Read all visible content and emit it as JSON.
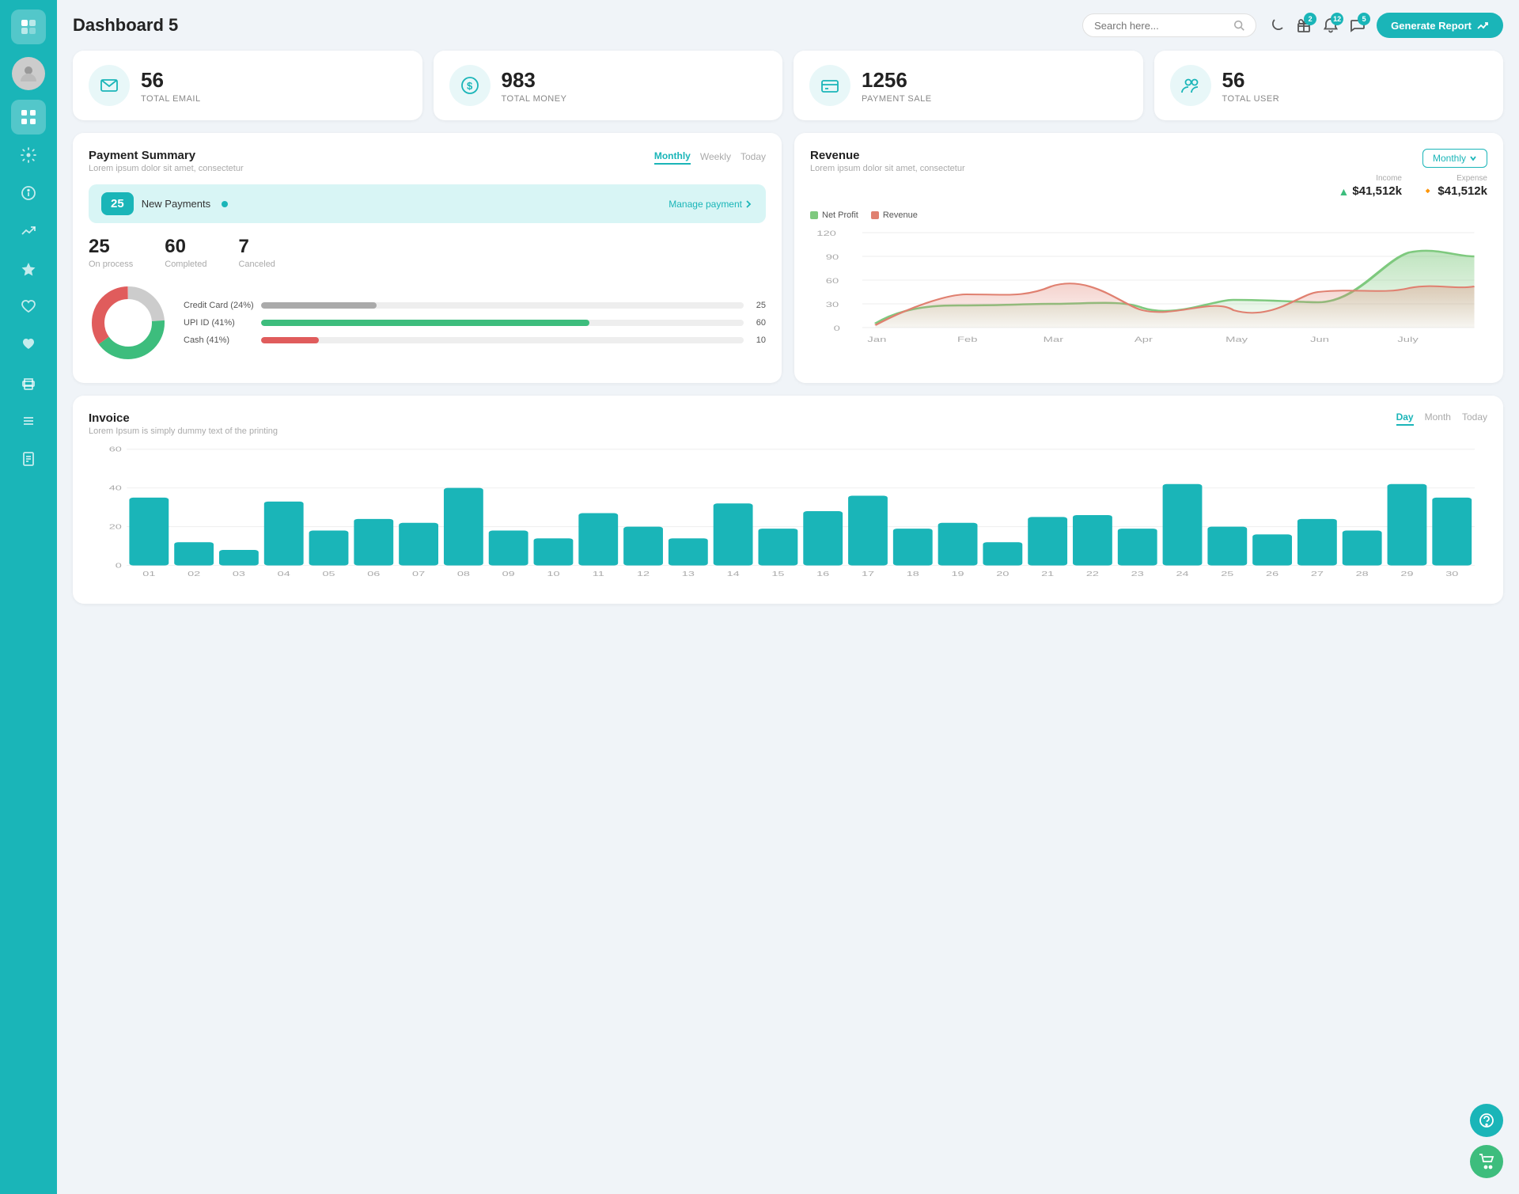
{
  "app": {
    "title": "Dashboard 5",
    "generate_report_label": "Generate Report"
  },
  "search": {
    "placeholder": "Search here..."
  },
  "header_icons": {
    "moon_badge": "",
    "gift_badge": "2",
    "bell_badge": "12",
    "chat_badge": "5"
  },
  "stats": [
    {
      "icon": "📋",
      "number": "56",
      "label": "TOTAL EMAIL"
    },
    {
      "icon": "💲",
      "number": "983",
      "label": "TOTAL MONEY"
    },
    {
      "icon": "💳",
      "number": "1256",
      "label": "PAYMENT SALE"
    },
    {
      "icon": "👥",
      "number": "56",
      "label": "TOTAL USER"
    }
  ],
  "payment_summary": {
    "title": "Payment Summary",
    "subtitle": "Lorem ipsum dolor sit amet, consectetur",
    "tabs": [
      "Monthly",
      "Weekly",
      "Today"
    ],
    "active_tab": "Monthly",
    "new_payments": {
      "count": "25",
      "label": "New Payments",
      "manage_link": "Manage payment"
    },
    "stats": [
      {
        "value": "25",
        "label": "On process"
      },
      {
        "value": "60",
        "label": "Completed"
      },
      {
        "value": "7",
        "label": "Canceled"
      }
    ],
    "progress_items": [
      {
        "label": "Credit Card (24%)",
        "pct": 24,
        "color": "#aaa",
        "value": "25"
      },
      {
        "label": "UPI ID (41%)",
        "pct": 68,
        "color": "#3dbd7d",
        "value": "60"
      },
      {
        "label": "Cash (41%)",
        "pct": 12,
        "color": "#e05c5c",
        "value": "10"
      }
    ]
  },
  "revenue": {
    "title": "Revenue",
    "subtitle": "Lorem ipsum dolor sit amet, consectetur",
    "active_tab": "Monthly",
    "income": {
      "label": "Income",
      "value": "$41,512k"
    },
    "expense": {
      "label": "Expense",
      "value": "$41,512k"
    },
    "legend": [
      {
        "label": "Net Profit",
        "color": "#7ec97e"
      },
      {
        "label": "Revenue",
        "color": "#e08070"
      }
    ],
    "x_labels": [
      "Jan",
      "Feb",
      "Mar",
      "Apr",
      "May",
      "Jun",
      "July"
    ],
    "y_labels": [
      "0",
      "30",
      "60",
      "90",
      "120"
    ],
    "net_profit_points": [
      5,
      28,
      30,
      25,
      35,
      32,
      95,
      90
    ],
    "revenue_points": [
      3,
      27,
      42,
      28,
      22,
      38,
      55,
      53
    ]
  },
  "invoice": {
    "title": "Invoice",
    "subtitle": "Lorem Ipsum is simply dummy text of the printing",
    "tabs": [
      "Day",
      "Month",
      "Today"
    ],
    "active_tab": "Day",
    "y_labels": [
      "0",
      "20",
      "40",
      "60"
    ],
    "x_labels": [
      "01",
      "02",
      "03",
      "04",
      "05",
      "06",
      "07",
      "08",
      "09",
      "10",
      "11",
      "12",
      "13",
      "14",
      "15",
      "16",
      "17",
      "18",
      "19",
      "20",
      "21",
      "22",
      "23",
      "24",
      "25",
      "26",
      "27",
      "28",
      "29",
      "30"
    ],
    "bar_values": [
      35,
      12,
      8,
      33,
      18,
      24,
      22,
      40,
      18,
      14,
      27,
      20,
      14,
      32,
      19,
      28,
      36,
      19,
      22,
      12,
      25,
      26,
      19,
      42,
      20,
      16,
      24,
      18,
      42,
      35
    ]
  },
  "sidebar": {
    "items": [
      {
        "icon": "📊",
        "name": "dashboard",
        "active": true
      },
      {
        "icon": "⚙️",
        "name": "settings",
        "active": false
      },
      {
        "icon": "ℹ️",
        "name": "info",
        "active": false
      },
      {
        "icon": "📈",
        "name": "analytics",
        "active": false
      },
      {
        "icon": "⭐",
        "name": "favorites",
        "active": false
      },
      {
        "icon": "♥",
        "name": "likes",
        "active": false
      },
      {
        "icon": "🖤",
        "name": "saved",
        "active": false
      },
      {
        "icon": "🖨️",
        "name": "print",
        "active": false
      },
      {
        "icon": "☰",
        "name": "menu",
        "active": false
      },
      {
        "icon": "📋",
        "name": "reports",
        "active": false
      }
    ]
  }
}
